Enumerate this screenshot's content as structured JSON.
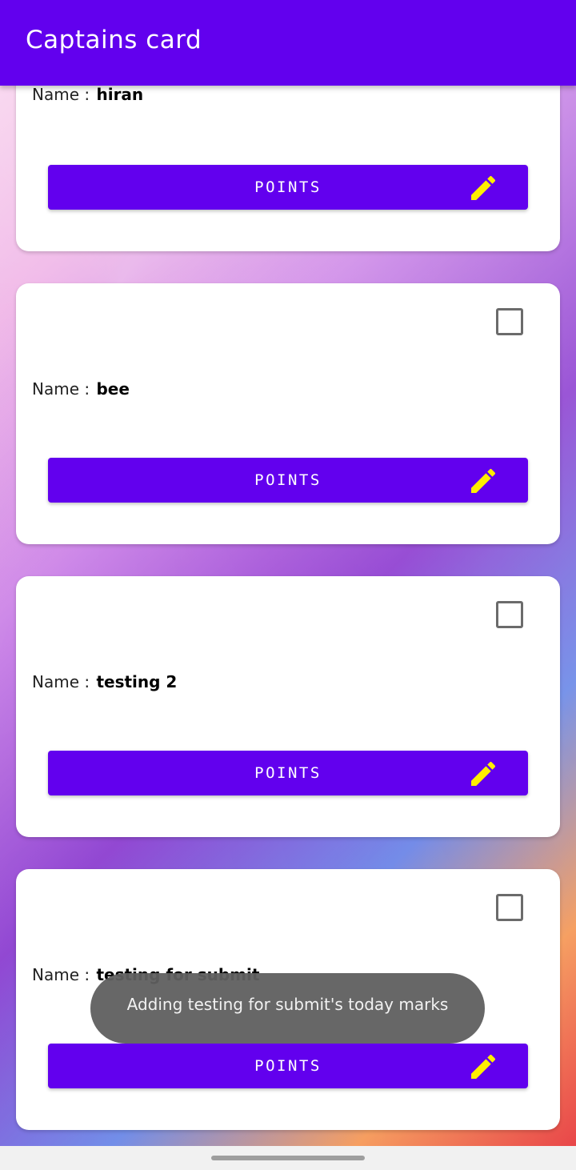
{
  "app": {
    "title": "Captains card"
  },
  "cards": [
    {
      "name_label": "Name :",
      "name_value": "hiran",
      "button_label": "POINTS",
      "has_checkbox": false
    },
    {
      "name_label": "Name :",
      "name_value": "bee",
      "button_label": "POINTS",
      "has_checkbox": true
    },
    {
      "name_label": "Name :",
      "name_value": "testing 2",
      "button_label": "POINTS",
      "has_checkbox": true
    },
    {
      "name_label": "Name :",
      "name_value": "testing for submit",
      "button_label": "POINTS",
      "has_checkbox": true
    }
  ],
  "toast": {
    "text": "Adding testing for submit's today marks"
  },
  "colors": {
    "primary": "#6200ee",
    "edit_icon": "#ffee00",
    "toast_bg": "#5f5f5f"
  },
  "icons": {
    "edit": "pencil-icon",
    "checkbox": "checkbox-unchecked-icon"
  }
}
